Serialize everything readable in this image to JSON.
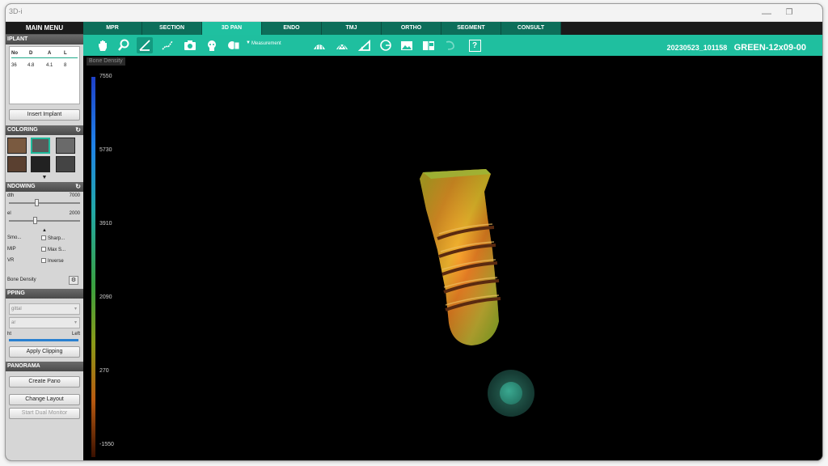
{
  "window": {
    "title": "3D-i"
  },
  "menu": {
    "main_label": "MAIN MENU"
  },
  "implant": {
    "section_label": "IPLANT",
    "headers": [
      "No",
      "D",
      "A",
      "L"
    ],
    "row": [
      "36",
      "4.8",
      "4.1",
      "8"
    ],
    "insert_button": "Insert Implant"
  },
  "coloring": {
    "section_label": "COLORING"
  },
  "windowing": {
    "section_label": "NDOWING",
    "width_label": "dth",
    "width_value": "7000",
    "level_label": "el",
    "level_value": "2000",
    "opt_smooth": "Smo...",
    "opt_sharp": "Sharp...",
    "opt_mip": "MIP",
    "opt_max": "Max S...",
    "opt_vr": "VR",
    "opt_inverse": "Inverse",
    "bone_density": "Bone Density"
  },
  "clipping": {
    "section_label": "PPING",
    "dropdown1": "gittal",
    "dropdown2": "ar",
    "right_label": "ht",
    "left_label": "Left",
    "apply_button": "Apply Clipping"
  },
  "panorama": {
    "section_label": "PANORAMA",
    "create_button": "Create Pano",
    "layout_button": "Change Layout",
    "dual_button": "Start Dual Monitor"
  },
  "tabs": [
    "MPR",
    "SECTION",
    "3D PAN",
    "ENDO",
    "TMJ",
    "ORTHO",
    "SEGMENT",
    "CONSULT"
  ],
  "toolbar": {
    "measurement_label": "Measurement",
    "help_label": "?",
    "study_date": "20230523_101158",
    "study_name": "GREEN-12x09-00"
  },
  "viewport": {
    "density_label": "Bone Density",
    "scale_ticks": [
      "7550",
      "5730",
      "3910",
      "2090",
      "270",
      "-1550"
    ]
  }
}
